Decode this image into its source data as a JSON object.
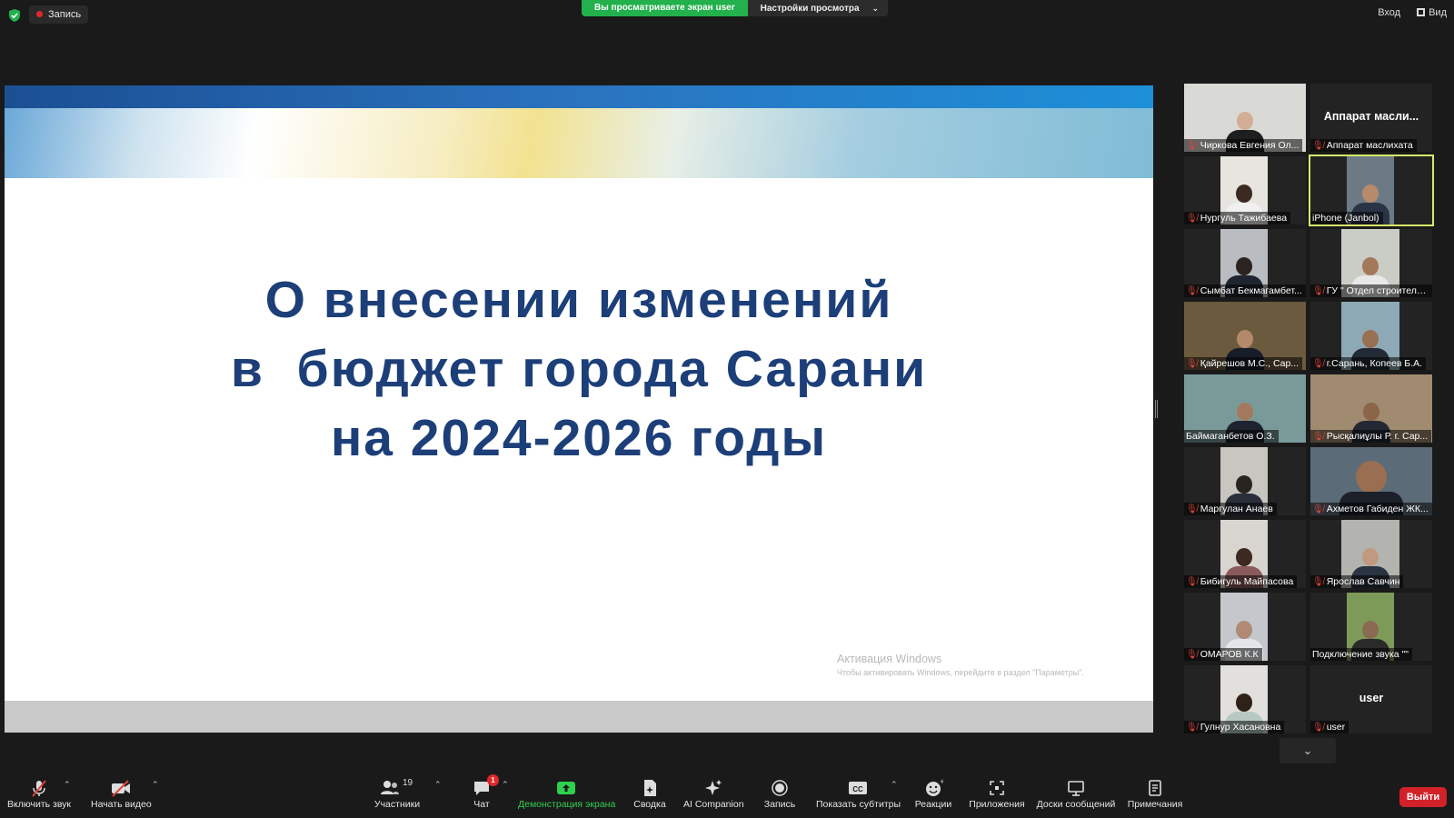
{
  "topbar": {
    "recording_label": "Запись",
    "share_status": "Вы просматриваете экран user",
    "view_options": "Настройки просмотра",
    "signin": "Вход",
    "view": "Вид"
  },
  "slide": {
    "title_lines": [
      "О внесении изменений",
      "в  бюджет города Сарани",
      "на 2024-2026 годы"
    ],
    "windows_activation_title": "Активация Windows",
    "windows_activation_hint": "Чтобы активировать Windows, перейдите в раздел \"Параметры\"."
  },
  "gallery": {
    "tiles": [
      {
        "name": "Чиркова Евгения Ол...",
        "big": ""
      },
      {
        "name": "Аппарат маслихата",
        "big": "Аппарат масли..."
      },
      {
        "name": "Нургуль Тажибаева",
        "big": ""
      },
      {
        "name": "iPhone (Janbol)",
        "big": ""
      },
      {
        "name": "Сымбат Бекмагамбет...",
        "big": ""
      },
      {
        "name": "ГУ \" Отдел строитель...",
        "big": ""
      },
      {
        "name": "Қайрешов М.С., Сар...",
        "big": ""
      },
      {
        "name": "г.Сарань, Копеев Б.А.",
        "big": ""
      },
      {
        "name": "Баймаганбетов О.З.",
        "big": ""
      },
      {
        "name": "Рысқалиұлы Р. г. Сар...",
        "big": ""
      },
      {
        "name": "Маргулан Анаев",
        "big": ""
      },
      {
        "name": "Ахметов Габиден ЖК...",
        "big": ""
      },
      {
        "name": "Бибигуль Майпасова",
        "big": ""
      },
      {
        "name": "Ярослав Савчин",
        "big": ""
      },
      {
        "name": "ОМАРОВ К.К",
        "big": ""
      },
      {
        "name": "Подключение звука \"\"",
        "big": ""
      },
      {
        "name": "Гулнур Хасановна",
        "big": ""
      },
      {
        "name": "user",
        "big": "user"
      }
    ]
  },
  "toolbar": {
    "unmute": "Включить звук",
    "start_video": "Начать видео",
    "participants": "Участники",
    "participants_count": "19",
    "chat": "Чат",
    "chat_badge": "1",
    "share_screen": "Демонстрация экрана",
    "summary": "Сводка",
    "ai_companion": "AI Companion",
    "record": "Запись",
    "captions": "Показать субтитры",
    "reactions": "Реакции",
    "apps": "Приложения",
    "whiteboards": "Доски сообщений",
    "notes": "Примечания",
    "leave": "Выйти"
  },
  "colors": {
    "share_green": "#22b14c",
    "slide_title": "#1d3f79",
    "leave_red": "#d1222a",
    "active_speaker": "#d8e86a"
  }
}
